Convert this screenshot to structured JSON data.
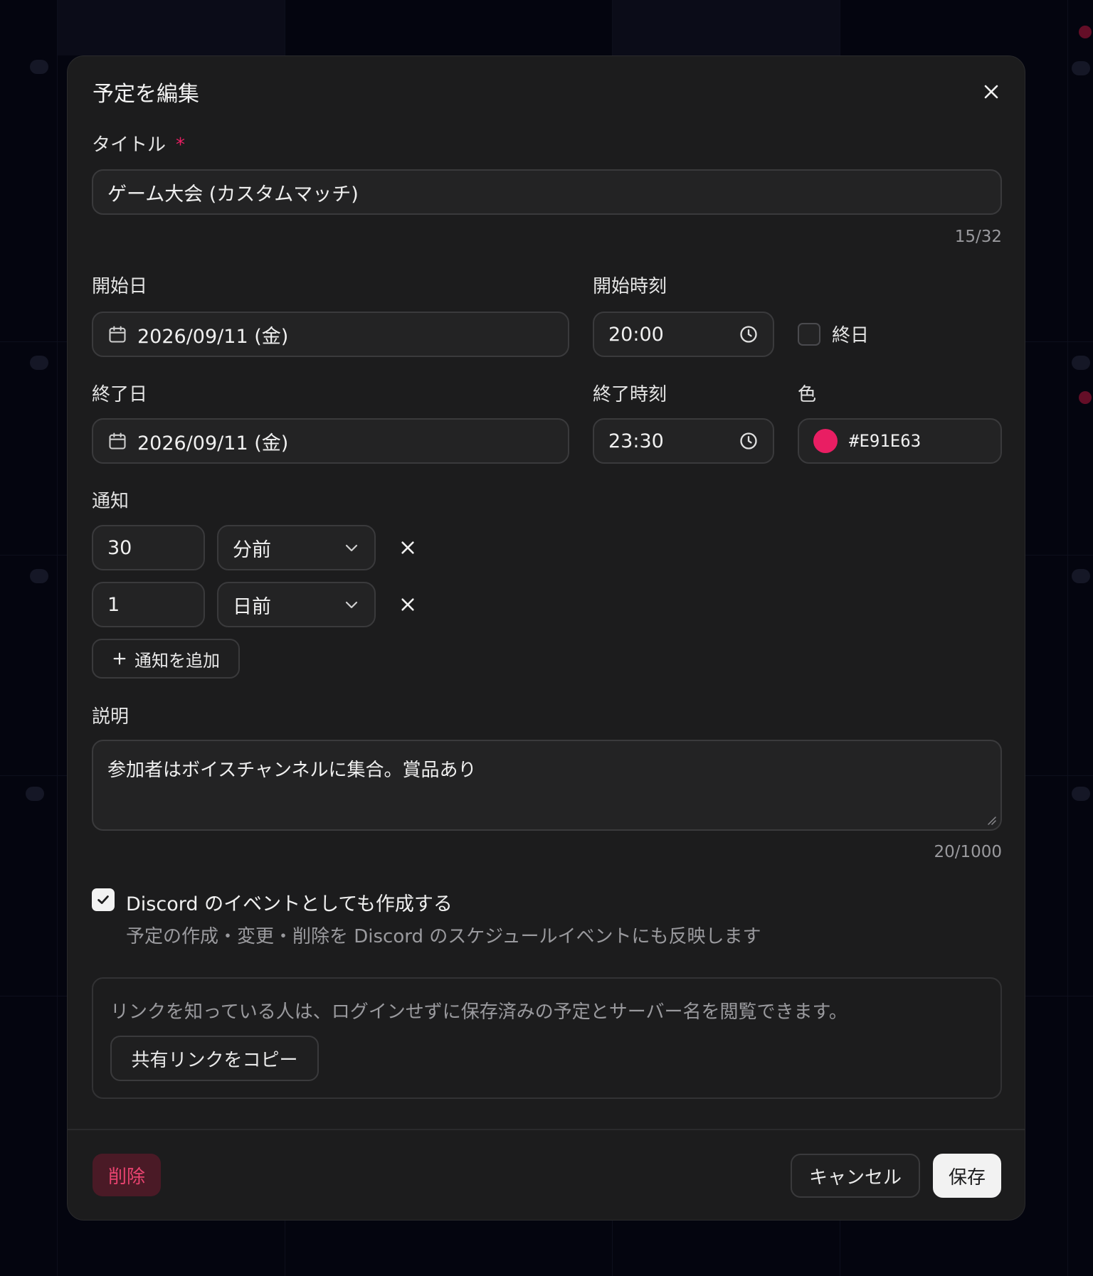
{
  "dialog": {
    "title": "予定を編集"
  },
  "title_field": {
    "label": "タイトル",
    "required_mark": "*",
    "value": "ゲーム大会 (カスタムマッチ)",
    "counter": "15/32"
  },
  "start": {
    "date_label": "開始日",
    "date_value": "2026/09/11 (金)",
    "time_label": "開始時刻",
    "time_value": "20:00"
  },
  "all_day": {
    "label": "終日",
    "checked": false
  },
  "end": {
    "date_label": "終了日",
    "date_value": "2026/09/11 (金)",
    "time_label": "終了時刻",
    "time_value": "23:30"
  },
  "color": {
    "label": "色",
    "value": "#E91E63",
    "swatch": "#E91E63"
  },
  "notifications": {
    "label": "通知",
    "items": [
      {
        "amount": "30",
        "unit": "分前"
      },
      {
        "amount": "1",
        "unit": "日前"
      }
    ],
    "add_label": "通知を追加"
  },
  "description": {
    "label": "説明",
    "value": "参加者はボイスチャンネルに集合。賞品あり",
    "counter": "20/1000"
  },
  "discord": {
    "checked": true,
    "label": "Discord のイベントとしても作成する",
    "help": "予定の作成・変更・削除を Discord のスケジュールイベントにも反映します"
  },
  "share": {
    "info": "リンクを知っている人は、ログインせずに保存済みの予定とサーバー名を閲覧できます。",
    "copy_label": "共有リンクをコピー"
  },
  "footer": {
    "delete_label": "削除",
    "cancel_label": "キャンセル",
    "save_label": "保存"
  },
  "icons": {
    "close": "close-icon",
    "calendar": "calendar-icon",
    "clock": "clock-icon",
    "chevron": "chevron-down-icon",
    "remove": "x-icon",
    "add": "plus-icon",
    "check": "check-icon"
  },
  "colors": {
    "accent": "#E91E63",
    "danger_bg": "#4a1a26",
    "danger_text": "#e8436f"
  }
}
